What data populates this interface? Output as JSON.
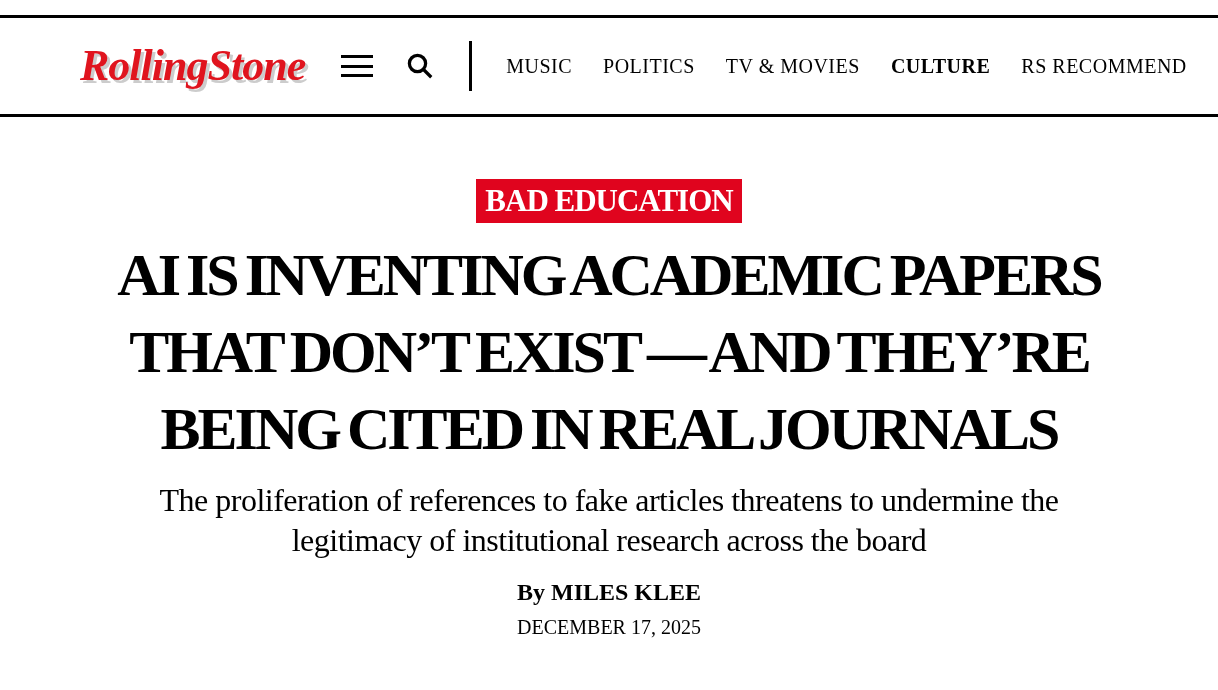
{
  "header": {
    "logo": "RollingStone",
    "nav": [
      {
        "label": "MUSIC",
        "selected": false
      },
      {
        "label": "POLITICS",
        "selected": false
      },
      {
        "label": "TV & MOVIES",
        "selected": false
      },
      {
        "label": "CULTURE",
        "selected": true
      },
      {
        "label": "RS RECOMMEND",
        "selected": false
      }
    ]
  },
  "article": {
    "category": "BAD EDUCATION",
    "headline": "AI IS INVENTING ACADEMIC PAPERS THAT DON’T EXIST — AND THEY’RE BEING CITED IN REAL JOURNALS",
    "subheadline": "The proliferation of references to fake articles threatens to undermine the legitimacy of institutional research across the board",
    "byline_prefix": "By",
    "author": "MILES KLEE",
    "date": "DECEMBER 17, 2025"
  }
}
